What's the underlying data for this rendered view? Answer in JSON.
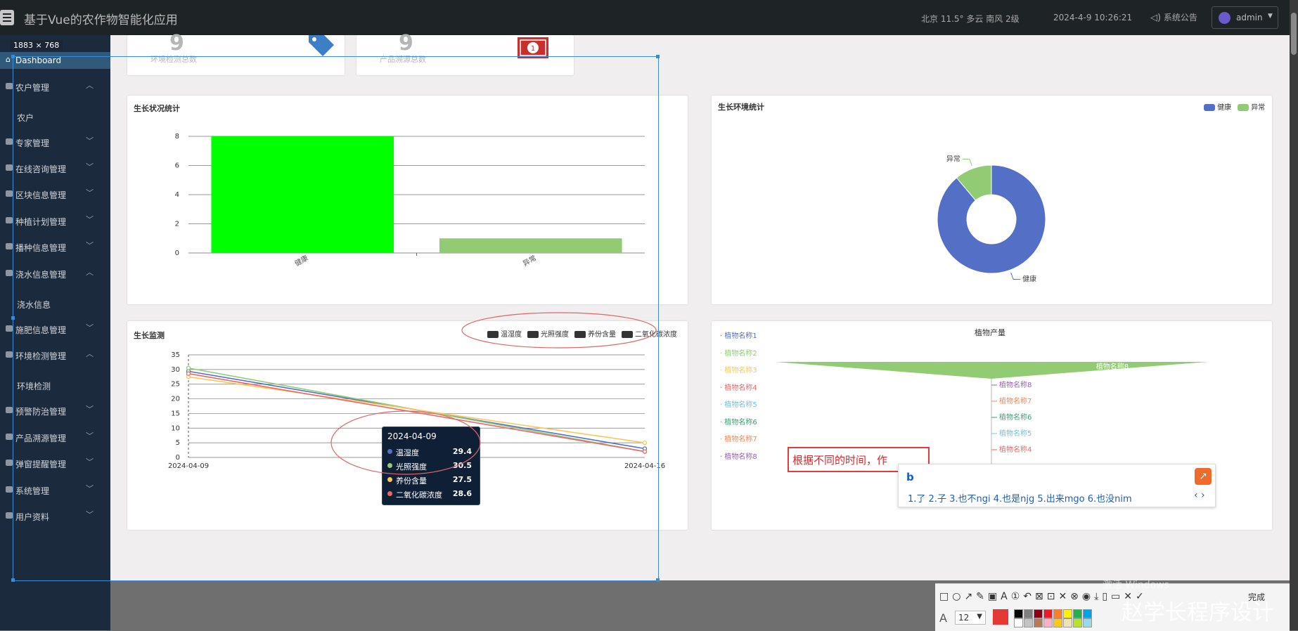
{
  "header": {
    "title": "基于Vue的农作物智能化应用",
    "weather": "北京  11.5°  多云  南风  2级",
    "datetime": "2024-4-9 10:26:21",
    "notice_label": "系统公告",
    "user_label": "admin"
  },
  "selection_size": "1883 × 768",
  "sidebar": {
    "dashboard": "Dashboard",
    "items": [
      {
        "label": "农户管理",
        "chev": "^"
      },
      {
        "label": "专家管理",
        "chev": "v"
      },
      {
        "label": "在线咨询管理",
        "chev": "v"
      },
      {
        "label": "区块信息管理",
        "chev": "v"
      },
      {
        "label": "种植计划管理",
        "chev": "v"
      },
      {
        "label": "播种信息管理",
        "chev": "v"
      },
      {
        "label": "浇水信息管理",
        "chev": "^"
      },
      {
        "label": "施肥信息管理",
        "chev": "v"
      },
      {
        "label": "环境检测管理",
        "chev": "^"
      },
      {
        "label": "预警防治管理",
        "chev": "v"
      },
      {
        "label": "产品溯源管理",
        "chev": "v"
      },
      {
        "label": "弹窗提醒管理",
        "chev": "v"
      },
      {
        "label": "系统管理",
        "chev": "v"
      },
      {
        "label": "用户资料",
        "chev": "v"
      }
    ],
    "subs": [
      "农户",
      "浇水信息",
      "环境检测"
    ]
  },
  "stats": [
    {
      "value": "9",
      "label": "环境检测总数"
    },
    {
      "value": "9",
      "label": "产品溯源总数"
    }
  ],
  "colors": {
    "primary": "#5470c6",
    "green": "#91cc75",
    "bright_green": "#00ff00",
    "yellow": "#fac858",
    "red": "#ee6666"
  },
  "chart_data": [
    {
      "type": "bar",
      "title": "生长状况统计",
      "categories": [
        "健康",
        "异常"
      ],
      "values": [
        8,
        1
      ],
      "ylim": [
        0,
        8
      ],
      "yticks": [
        "0",
        "2",
        "4",
        "6",
        "8"
      ]
    },
    {
      "type": "pie",
      "title": "生长环境统计",
      "legend": [
        "健康",
        "异常"
      ],
      "labels": [
        "健康",
        "异常"
      ],
      "values": [
        8,
        1
      ]
    },
    {
      "type": "line",
      "title": "生长监测",
      "legend": [
        "温湿度",
        "光照强度",
        "养份含量",
        "二氧化碳浓度"
      ],
      "x": [
        "2024-04-09",
        "2024-04-16"
      ],
      "ylim": [
        0,
        35
      ],
      "yticks": [
        "0",
        "5",
        "10",
        "15",
        "20",
        "25",
        "30",
        "35"
      ],
      "series": [
        {
          "name": "温湿度",
          "values": [
            29.4,
            3
          ]
        },
        {
          "name": "光照强度",
          "values": [
            30.5,
            2
          ]
        },
        {
          "name": "养份含量",
          "values": [
            27.5,
            5
          ]
        },
        {
          "name": "二氧化碳浓度",
          "values": [
            28.6,
            2
          ]
        }
      ],
      "tooltip": {
        "date": "2024-04-09",
        "rows": [
          {
            "name": "温湿度",
            "value": "29.4"
          },
          {
            "name": "光照强度",
            "value": "30.5"
          },
          {
            "name": "养份含量",
            "value": "27.5"
          },
          {
            "name": "二氧化碳浓度",
            "value": "28.6"
          }
        ]
      }
    },
    {
      "type": "funnel",
      "title": "植物产量",
      "legend": [
        "植物名称1",
        "植物名称2",
        "植物名称3",
        "植物名称4",
        "植物名称5",
        "植物名称6",
        "植物名称7",
        "植物名称8"
      ],
      "labels": [
        "植物名称8",
        "植物名称7",
        "植物名称6",
        "植物名称5",
        "植物名称4"
      ]
    }
  ],
  "ime": {
    "typed": "根据不同的时间，作",
    "input": "b",
    "candidates": "1.了  2.子  3.也不ngi  4.也是njg  5.出来mgo  6.也没nim"
  },
  "toolbar": {
    "done": "完成",
    "font_size": "12",
    "watermark": "赵学长程序设计",
    "watermark_small": "激活 Windows"
  }
}
